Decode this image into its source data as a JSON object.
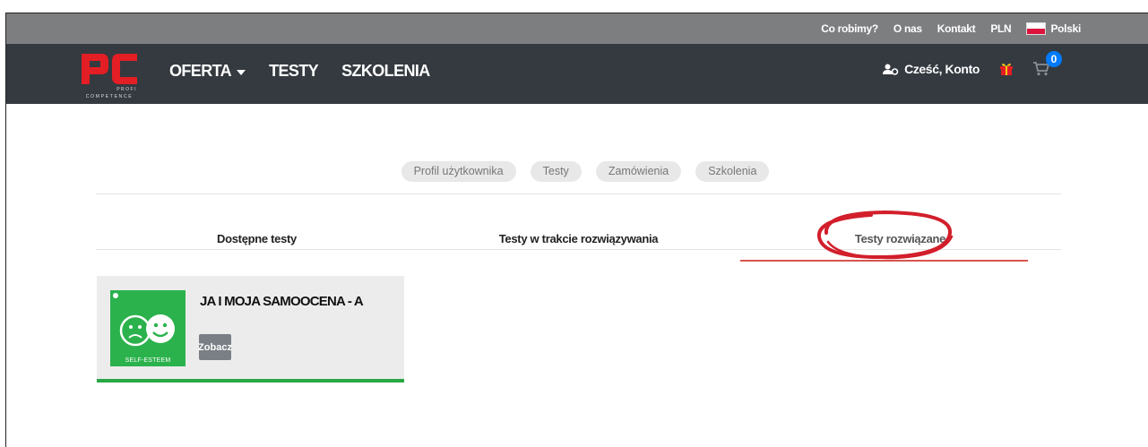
{
  "topbar": {
    "links": [
      "Co robimy?",
      "O nas",
      "Kontakt",
      "PLN"
    ],
    "language": "Polski"
  },
  "navbar": {
    "logo": {
      "text": "PC",
      "sub_top": "PROFI",
      "sub_bottom": "COMPETENCE",
      "color": "#e31e24"
    },
    "menu": [
      "OFERTA",
      "TESTY",
      "SZKOLENIA"
    ],
    "account_label": "Cześć, Konto",
    "cart_count": "0"
  },
  "account_tabs": [
    "Profil użytkownika",
    "Testy",
    "Zamówienia",
    "Szkolenia"
  ],
  "test_tabs": {
    "items": [
      "Dostępne testy",
      "Testy w trakcie rozwiązywania",
      "Testy rozwiązane"
    ],
    "active": "Testy rozwiązane"
  },
  "card": {
    "title": "JA I MOJA SAMOOCENA - A",
    "thumb_caption": "SELF-ESTEEM",
    "button_label": "Zobacz"
  },
  "colors": {
    "topbar": "#7d7e80",
    "navbar": "#343a40",
    "accent_red": "#e31e24",
    "badge": "#007bff",
    "card_border": "#28a745",
    "thumb": "#2bb24c"
  }
}
